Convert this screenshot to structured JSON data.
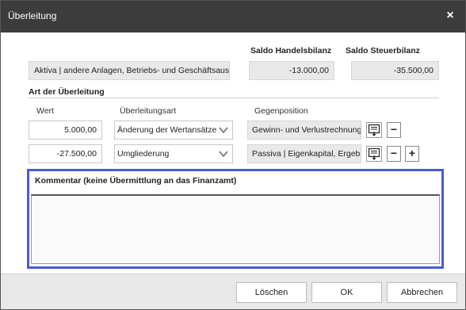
{
  "window": {
    "title": "Überleitung",
    "close_glyph": "×"
  },
  "top": {
    "account_value": "Aktiva | andere Anlagen, Betriebs- und Geschäftsaussta",
    "saldo_handelsbilanz_label": "Saldo Handelsbilanz",
    "saldo_handelsbilanz_value": "-13.000,00",
    "saldo_steuerbilanz_label": "Saldo Steuerbilanz",
    "saldo_steuerbilanz_value": "-35.500,00"
  },
  "section": {
    "title": "Art der Überleitung",
    "col_wert": "Wert",
    "col_art": "Überleitungsart",
    "col_gegenposition": "Gegenposition"
  },
  "rows": [
    {
      "wert": "5.000,00",
      "art": "Änderung der Wertansätze",
      "gegenposition": "Gewinn- und Verlustrechnung"
    },
    {
      "wert": "-27.500,00",
      "art": "Umgliederung",
      "gegenposition": "Passiva | Eigenkapital, Ergebn"
    }
  ],
  "buttons": {
    "minus": "−",
    "plus": "+"
  },
  "comment": {
    "label": "Kommentar (keine Übermittlung an das Finanzamt)",
    "value": ""
  },
  "footer": {
    "delete_label": "Löschen",
    "ok_label": "OK",
    "cancel_label": "Abbrechen"
  },
  "colors": {
    "titlebar": "#3c3c3c",
    "highlight_border": "#4a5bd4"
  }
}
